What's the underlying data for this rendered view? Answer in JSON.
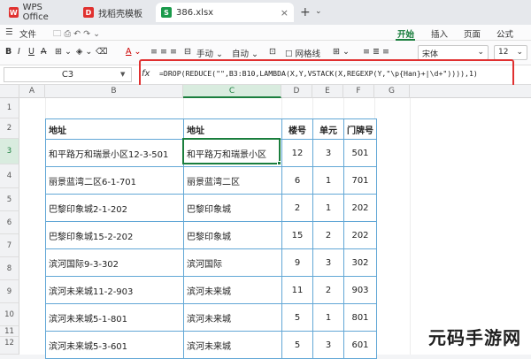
{
  "tabs": [
    {
      "label": "WPS Office",
      "icon": "wps-logo-icon",
      "color": "#e0312f"
    },
    {
      "label": "找稻壳模板",
      "icon": "docer-icon",
      "color": "#e0312f"
    },
    {
      "label": "386.xlsx",
      "icon": "spreadsheet-icon",
      "color": "#1a9a4b",
      "active": true
    }
  ],
  "ribbon_tabs": [
    {
      "label": "开始",
      "active": true
    },
    {
      "label": "插入"
    },
    {
      "label": "页面"
    },
    {
      "label": "公式"
    }
  ],
  "toolbar": {
    "menu_label": "文件",
    "wrap_label": "手动",
    "auto_label": "自动",
    "gridlines_label": "网格线",
    "font_name": "宋体",
    "font_size": "12"
  },
  "formula_bar": {
    "cell_ref": "C3",
    "fx": "fx",
    "formula": "=DROP(REDUCE(\"\",B3:B10,LAMBDA(X,Y,VSTACK(X,REGEXP(Y,\"\\p{Han}+|\\d+\")))),1)"
  },
  "columns": [
    "A",
    "B",
    "C",
    "D",
    "E",
    "F",
    "G"
  ],
  "rows": [
    "1",
    "2",
    "3",
    "4",
    "5",
    "6",
    "7",
    "8",
    "9",
    "10",
    "11",
    "12"
  ],
  "table": {
    "headers": [
      "地址",
      "地址",
      "楼号",
      "单元",
      "门牌号"
    ],
    "rows": [
      [
        "和平路万和瑞景小区12-3-501",
        "和平路万和瑞景小区",
        "12",
        "3",
        "501"
      ],
      [
        "丽景蓝湾二区6-1-701",
        "丽景蓝湾二区",
        "6",
        "1",
        "701"
      ],
      [
        "巴黎印象城2-1-202",
        "巴黎印象城",
        "2",
        "1",
        "202"
      ],
      [
        "巴黎印象城15-2-202",
        "巴黎印象城",
        "15",
        "2",
        "202"
      ],
      [
        "滨河国际9-3-302",
        "滨河国际",
        "9",
        "3",
        "302"
      ],
      [
        "滨河未来城11-2-903",
        "滨河未来城",
        "11",
        "2",
        "903"
      ],
      [
        "滨河未来城5-1-801",
        "滨河未来城",
        "5",
        "1",
        "801"
      ],
      [
        "滨河未来城5-3-601",
        "滨河未来城",
        "5",
        "3",
        "601"
      ]
    ]
  },
  "watermark": "元码手游网",
  "colors": {
    "accent": "#1a7e3d",
    "highlight": "#e03030",
    "table_border": "#62a7d6"
  }
}
